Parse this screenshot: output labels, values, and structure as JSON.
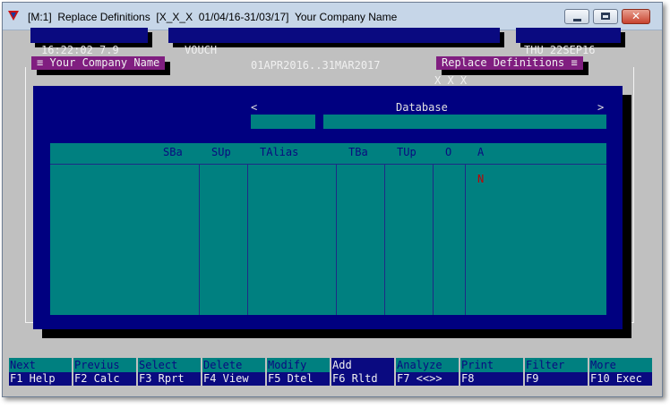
{
  "window": {
    "title": "[M:1]  Replace Definitions  [X_X_X  01/04/16-31/03/17]  Your Company Name",
    "minimize_glyph": "",
    "close_glyph": "✕"
  },
  "status_bar": {
    "time_version": "16:22:02 7.9",
    "vouch": "VOUCH",
    "period": "01APR2016..31MAR2017",
    "company_code": "X_X_X",
    "date": "THU 22SEP16"
  },
  "panels": {
    "company_tag": "≡ Your Company Name",
    "screen_tag": "Replace Definitions ≡"
  },
  "database_header": {
    "left_arrow": "<",
    "label": "Database",
    "right_arrow": ">"
  },
  "grid": {
    "columns": [
      "SBa",
      "SUp",
      "TAlias",
      "TBa",
      "TUp",
      "O",
      "A"
    ],
    "rows": [
      {
        "A": "N"
      }
    ]
  },
  "function_keys": [
    {
      "top": "Next",
      "bottom": "F1 Help"
    },
    {
      "top": "Previus",
      "bottom": "F2 Calc"
    },
    {
      "top": "Select",
      "bottom": "F3 Rprt"
    },
    {
      "top": "Delete",
      "bottom": "F4 View"
    },
    {
      "top": "Modify",
      "bottom": "F5 Dtel"
    },
    {
      "top": "Add",
      "bottom": "F6 Rltd"
    },
    {
      "top": "Analyze",
      "bottom": "F7 <<>>"
    },
    {
      "top": "Print",
      "bottom": "F8"
    },
    {
      "top": "Filter",
      "bottom": "F9"
    },
    {
      "top": "More",
      "bottom": "F10 Exec"
    }
  ],
  "colors": {
    "panel_blue": "#000080",
    "teal": "#008080",
    "purple_tag": "#801e80",
    "accent_red": "#c00000"
  }
}
